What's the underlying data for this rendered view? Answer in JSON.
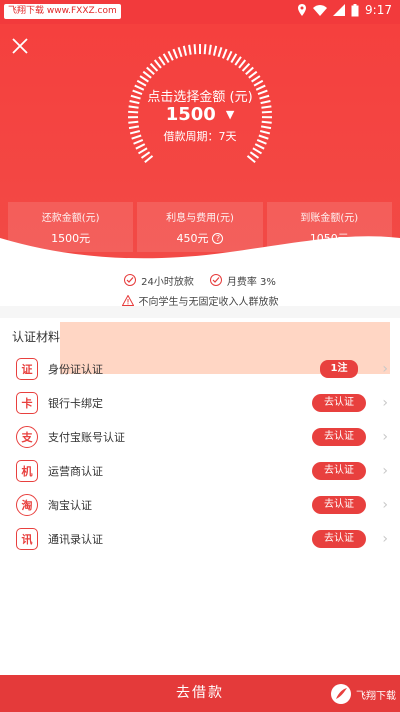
{
  "status": {
    "wm_tag": "飞翔下载 www.FXXZ.com",
    "time": "9:17"
  },
  "hero": {
    "hint": "点击选择金额 (元)",
    "amount": "1500",
    "period": "借款周期：7天"
  },
  "summary": [
    {
      "label": "还款金额(元)",
      "value": "1500元"
    },
    {
      "label": "利息与费用(元)",
      "value": "450元"
    },
    {
      "label": "到账金额(元)",
      "value": "1050元"
    }
  ],
  "notes": {
    "note1": "24小时放款",
    "note2": "月费率 3%",
    "note3": "不向学生与无固定收入人群放款"
  },
  "section_title": "认证材料",
  "items": [
    {
      "label": "身份证认证",
      "btn": "",
      "icon_text": "证"
    },
    {
      "label": "银行卡绑定",
      "btn": "去认证",
      "icon_text": "卡"
    },
    {
      "label": "支付宝账号认证",
      "btn": "去认证",
      "icon_text": "支"
    },
    {
      "label": "运营商认证",
      "btn": "去认证",
      "icon_text": "机"
    },
    {
      "label": "淘宝认证",
      "btn": "去认证",
      "icon_text": "淘"
    },
    {
      "label": "通讯录认证",
      "btn": "去认证",
      "icon_text": "讯"
    }
  ],
  "banner_accent": "1注",
  "bottom": {
    "label": "去借款",
    "wm": "飞翔下载"
  },
  "colors": {
    "primary": "#e8403e",
    "hero": "#f5403e"
  }
}
